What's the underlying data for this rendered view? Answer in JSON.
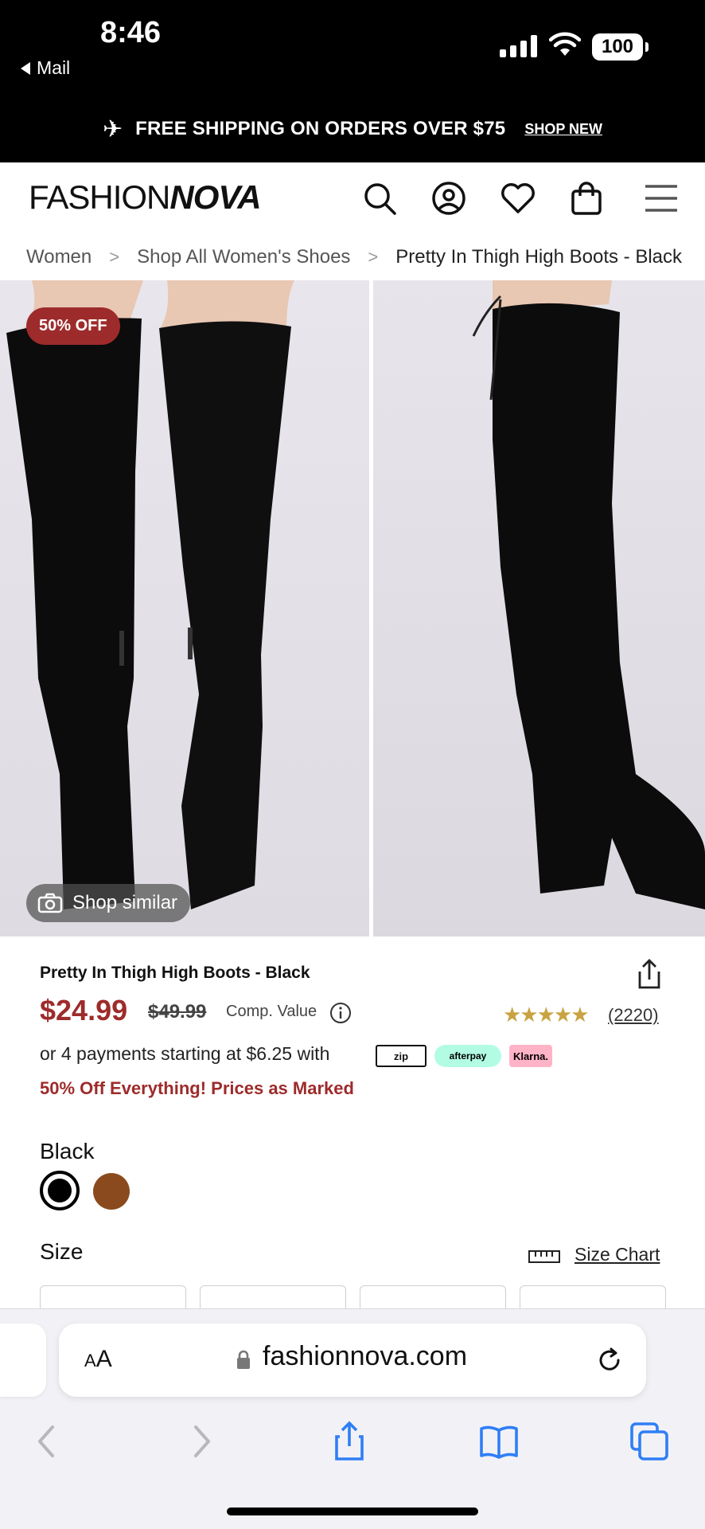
{
  "status_bar": {
    "time": "8:46",
    "back_label": "Mail",
    "battery": "100"
  },
  "promo_bar": {
    "icon": "airplane-icon",
    "text": "FREE SHIPPING ON ORDERS OVER $75",
    "link": "SHOP NEW"
  },
  "header": {
    "logo_light": "FASHION",
    "logo_bold": "NOVA",
    "icons": [
      "search-icon",
      "account-icon",
      "heart-icon",
      "bag-icon",
      "menu-icon"
    ]
  },
  "breadcrumb": {
    "items": [
      "Women",
      "Shop All Women's Shoes",
      "Pretty In Thigh High Boots - Black"
    ],
    "separator": ">"
  },
  "gallery": {
    "badge": "50% OFF",
    "shop_similar": "Shop similar"
  },
  "product": {
    "title": "Pretty In Thigh High Boots - Black",
    "price": "$24.99",
    "original_price": "$49.99",
    "comp_value": "Comp. Value",
    "rating_stars": "★★★★★",
    "review_count": "(2220)",
    "installments": "or 4 payments starting at $6.25 with",
    "payment_providers": [
      "zip",
      "afterpay",
      "Klarna."
    ],
    "promo_note": "50% Off Everything! Prices as Marked",
    "selected_color": "Black",
    "colors": [
      "#000000",
      "#8b4a1d"
    ],
    "size_label": "Size",
    "size_chart": "Size Chart"
  },
  "browser": {
    "aa_label": "AA",
    "url": "fashionnova.com"
  },
  "colors": {
    "accent": "#9e2b2b",
    "promo_bg": "#000000",
    "star": "#c9a341",
    "safari_blue": "#2f7ef6"
  }
}
